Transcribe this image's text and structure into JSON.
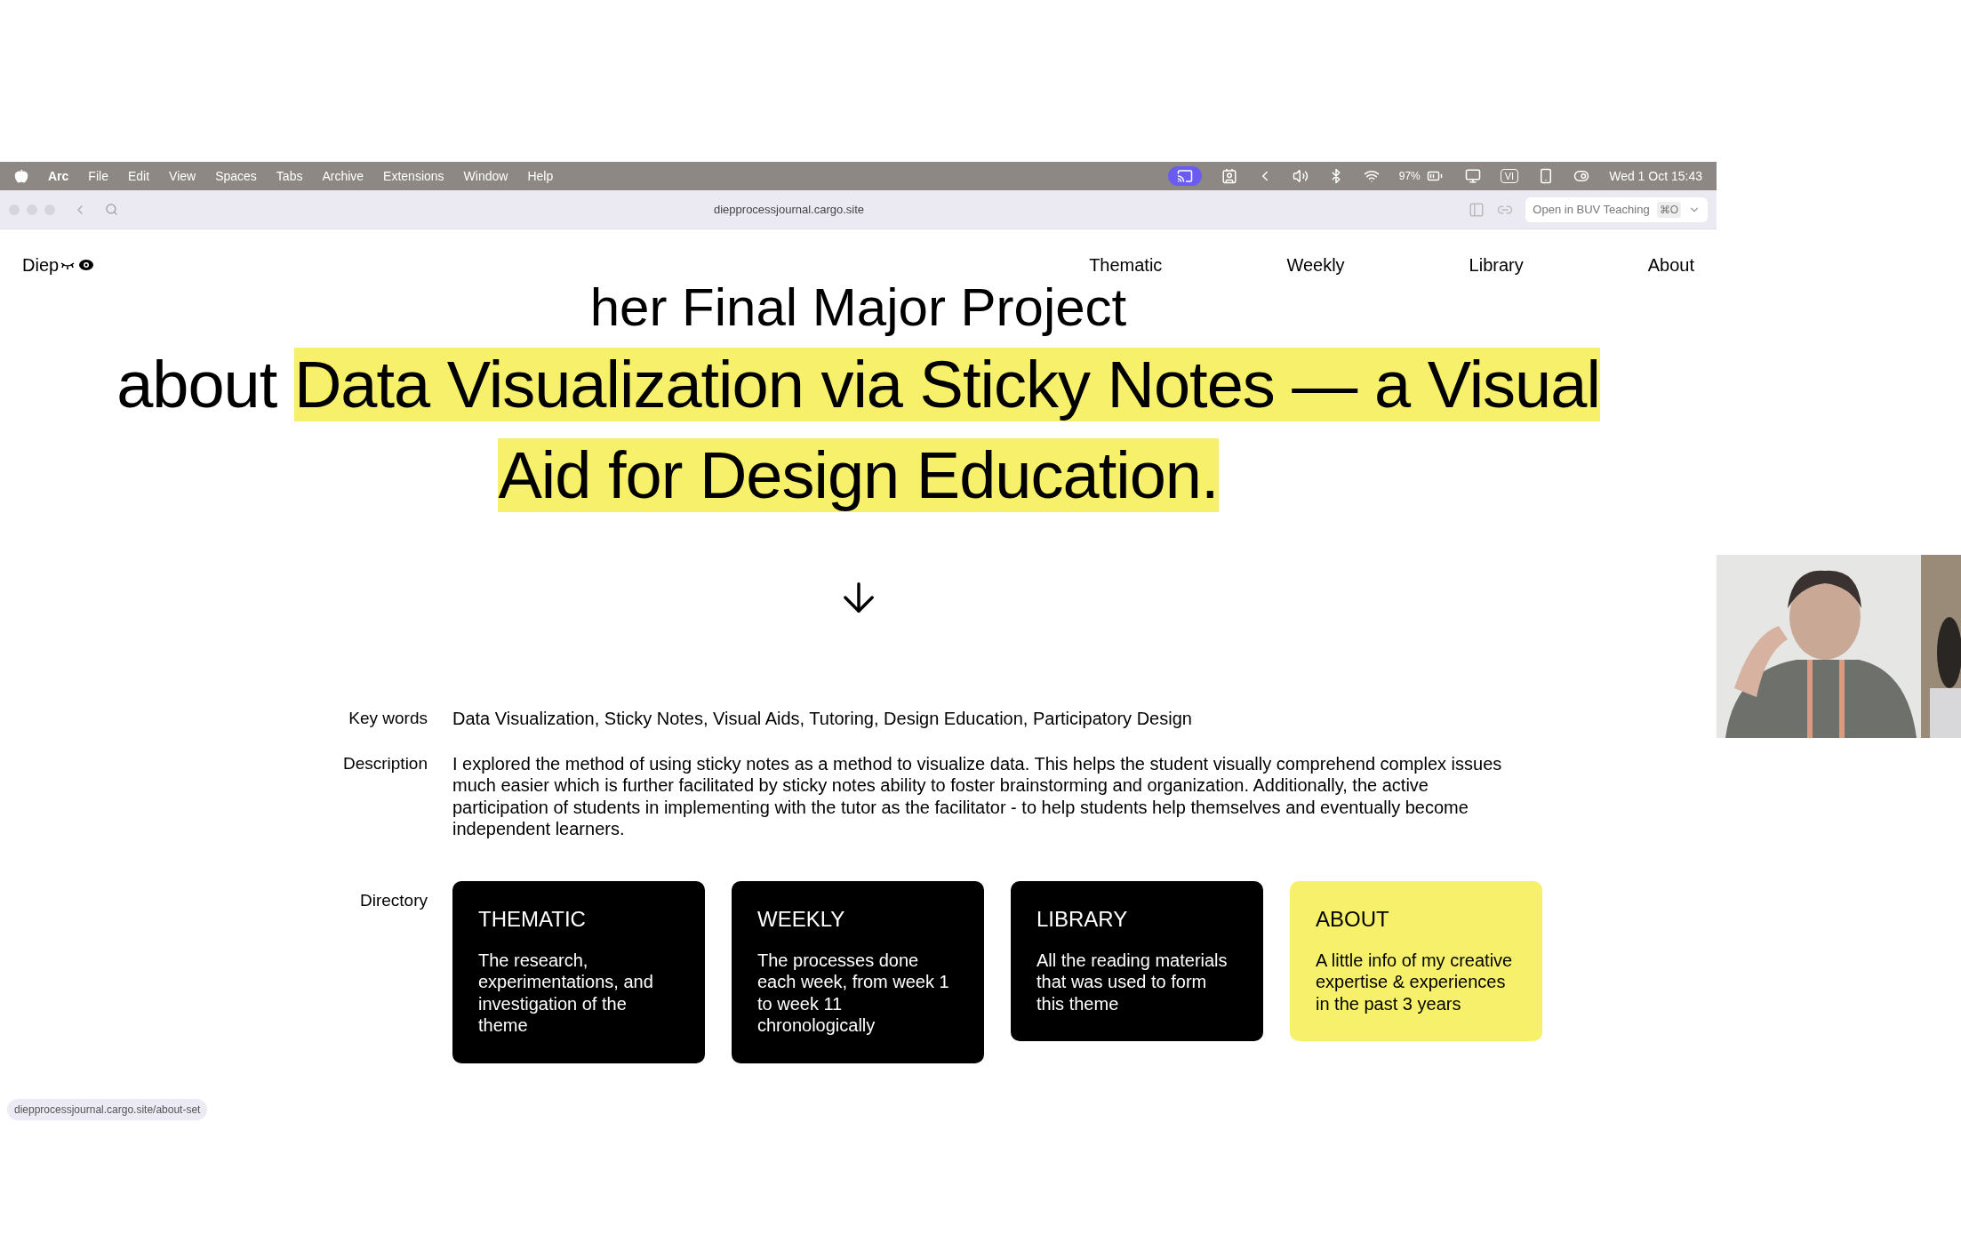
{
  "menu_bar": {
    "app": "Arc",
    "items": [
      "File",
      "Edit",
      "View",
      "Spaces",
      "Tabs",
      "Archive",
      "Extensions",
      "Window",
      "Help"
    ],
    "battery": "97%",
    "input_method": "VI",
    "clock": "Wed 1 Oct 15:43"
  },
  "toolbar": {
    "url": "diepprocessjournal.cargo.site",
    "open_in": "Open in BUV Teaching",
    "shortcut": "⌘O"
  },
  "site": {
    "logo": "Diep",
    "nav": [
      "Thematic",
      "Weekly",
      "Library",
      "About"
    ]
  },
  "headline": {
    "line1": "her Final Major Project",
    "lead": "about",
    "highlight": "Data Visualization via Sticky Notes — a Visual Aid for Design Education."
  },
  "details": [
    {
      "label": "Key words",
      "value": "Data Visualization, Sticky Notes, Visual Aids, Tutoring, Design Education, Participatory Design"
    },
    {
      "label": "Description",
      "value": "I explored the method of using sticky notes as a method to visualize data. This helps the student visually comprehend complex issues much easier which is further facilitated by sticky notes ability to foster brainstorming and organization. Additionally, the active participation of students in implementing with the tutor as the facilitator - to help students help themselves and eventually become independent learners."
    }
  ],
  "directory": {
    "label": "Directory",
    "cards": [
      {
        "title": "THEMATIC",
        "text": "The research, experimentations, and investigation of the theme",
        "highlighted": false
      },
      {
        "title": "WEEKLY",
        "text": "The processes done each week, from week 1 to week 11 chronologically",
        "highlighted": false
      },
      {
        "title": "LIBRARY",
        "text": "All the reading materials that was used to form this theme",
        "highlighted": false
      },
      {
        "title": "ABOUT",
        "text": "A little info of my creative expertise & experiences in the past 3 years",
        "highlighted": true
      }
    ]
  },
  "status_link": "diepprocessjournal.cargo.site/about-set"
}
